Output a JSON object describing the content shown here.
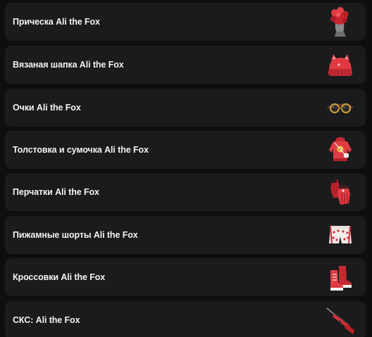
{
  "items": [
    {
      "label": "Прическа Ali the Fox",
      "icon": "red-hair-head-icon"
    },
    {
      "label": "Вязаная шапка Ali the Fox",
      "icon": "red-knit-hat-icon"
    },
    {
      "label": "Очки Ali the Fox",
      "icon": "goggles-icon"
    },
    {
      "label": "Толстовка и сумочка Ali the Fox",
      "icon": "red-hoodie-bag-icon"
    },
    {
      "label": "Перчатки Ali the Fox",
      "icon": "red-gloves-icon"
    },
    {
      "label": "Пижамные шорты Ali the Fox",
      "icon": "pajama-shorts-icon"
    },
    {
      "label": "Кроссовки Ali the Fox",
      "icon": "red-sneakers-icon"
    },
    {
      "label": "СКС: Ali the Fox",
      "icon": "sks-rifle-icon"
    }
  ],
  "colors": {
    "background": "#0e0e10",
    "card": "#1b1b1e",
    "text": "#f2f2f2",
    "accent_red": "#d8303a"
  }
}
